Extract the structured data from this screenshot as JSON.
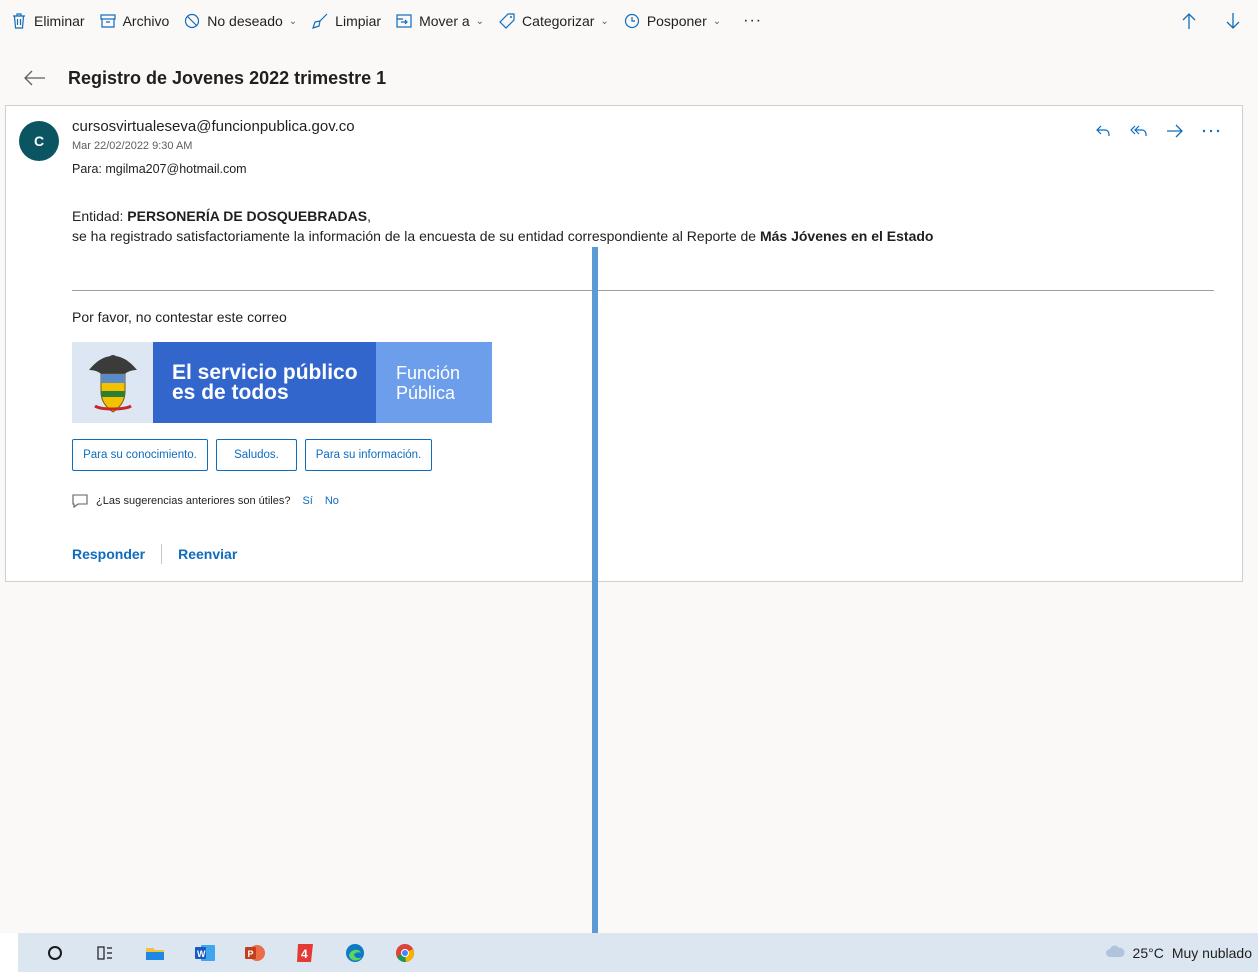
{
  "toolbar": {
    "items": [
      {
        "label": "Eliminar",
        "icon": "trash-icon",
        "dropdown": false
      },
      {
        "label": "Archivo",
        "icon": "archive-icon",
        "dropdown": false
      },
      {
        "label": "No deseado",
        "icon": "block-icon",
        "dropdown": true
      },
      {
        "label": "Limpiar",
        "icon": "broom-icon",
        "dropdown": false
      },
      {
        "label": "Mover a",
        "icon": "folder-move-icon",
        "dropdown": true
      },
      {
        "label": "Categorizar",
        "icon": "tag-icon",
        "dropdown": true
      },
      {
        "label": "Posponer",
        "icon": "clock-icon",
        "dropdown": true
      }
    ],
    "more": "···"
  },
  "subject": "Registro de Jovenes 2022 trimestre 1",
  "message": {
    "avatar_letter": "C",
    "sender": "cursosvirtualeseva@funcionpublica.gov.co",
    "date": "Mar 22/02/2022 9:30 AM",
    "to_label": "Para:",
    "to": "mgilma207@hotmail.com",
    "entity_label": "Entidad: ",
    "entity_name": "PERSONERÍA DE DOSQUEBRADAS",
    "entity_suffix": ",",
    "line2_prefix": "se ha registrado satisfactoriamente la información de la encuesta de su entidad correspondiente al Reporte de ",
    "line2_bold": "Más Jóvenes en el Estado",
    "note": "Por favor, no contestar este correo",
    "banner": {
      "line1": "El servicio público",
      "line2": "es de todos",
      "brand1": "Función",
      "brand2": "Pública"
    },
    "quick_replies": [
      "Para su conocimiento.",
      "Saludos.",
      "Para su información."
    ],
    "feedback": {
      "question": "¿Las sugerencias anteriores son útiles?",
      "yes": "Sí",
      "no": "No"
    },
    "reply": "Responder",
    "forward": "Reenviar"
  },
  "taskbar": {
    "weather_temp": "25°C",
    "weather_desc": "Muy nublado"
  },
  "colors": {
    "accent": "#0f6cbd",
    "avatar": "#0b5563",
    "banner_mid": "#3366cc",
    "banner_right": "#6d9eeb",
    "overlay_line": "#5b9bd5"
  }
}
